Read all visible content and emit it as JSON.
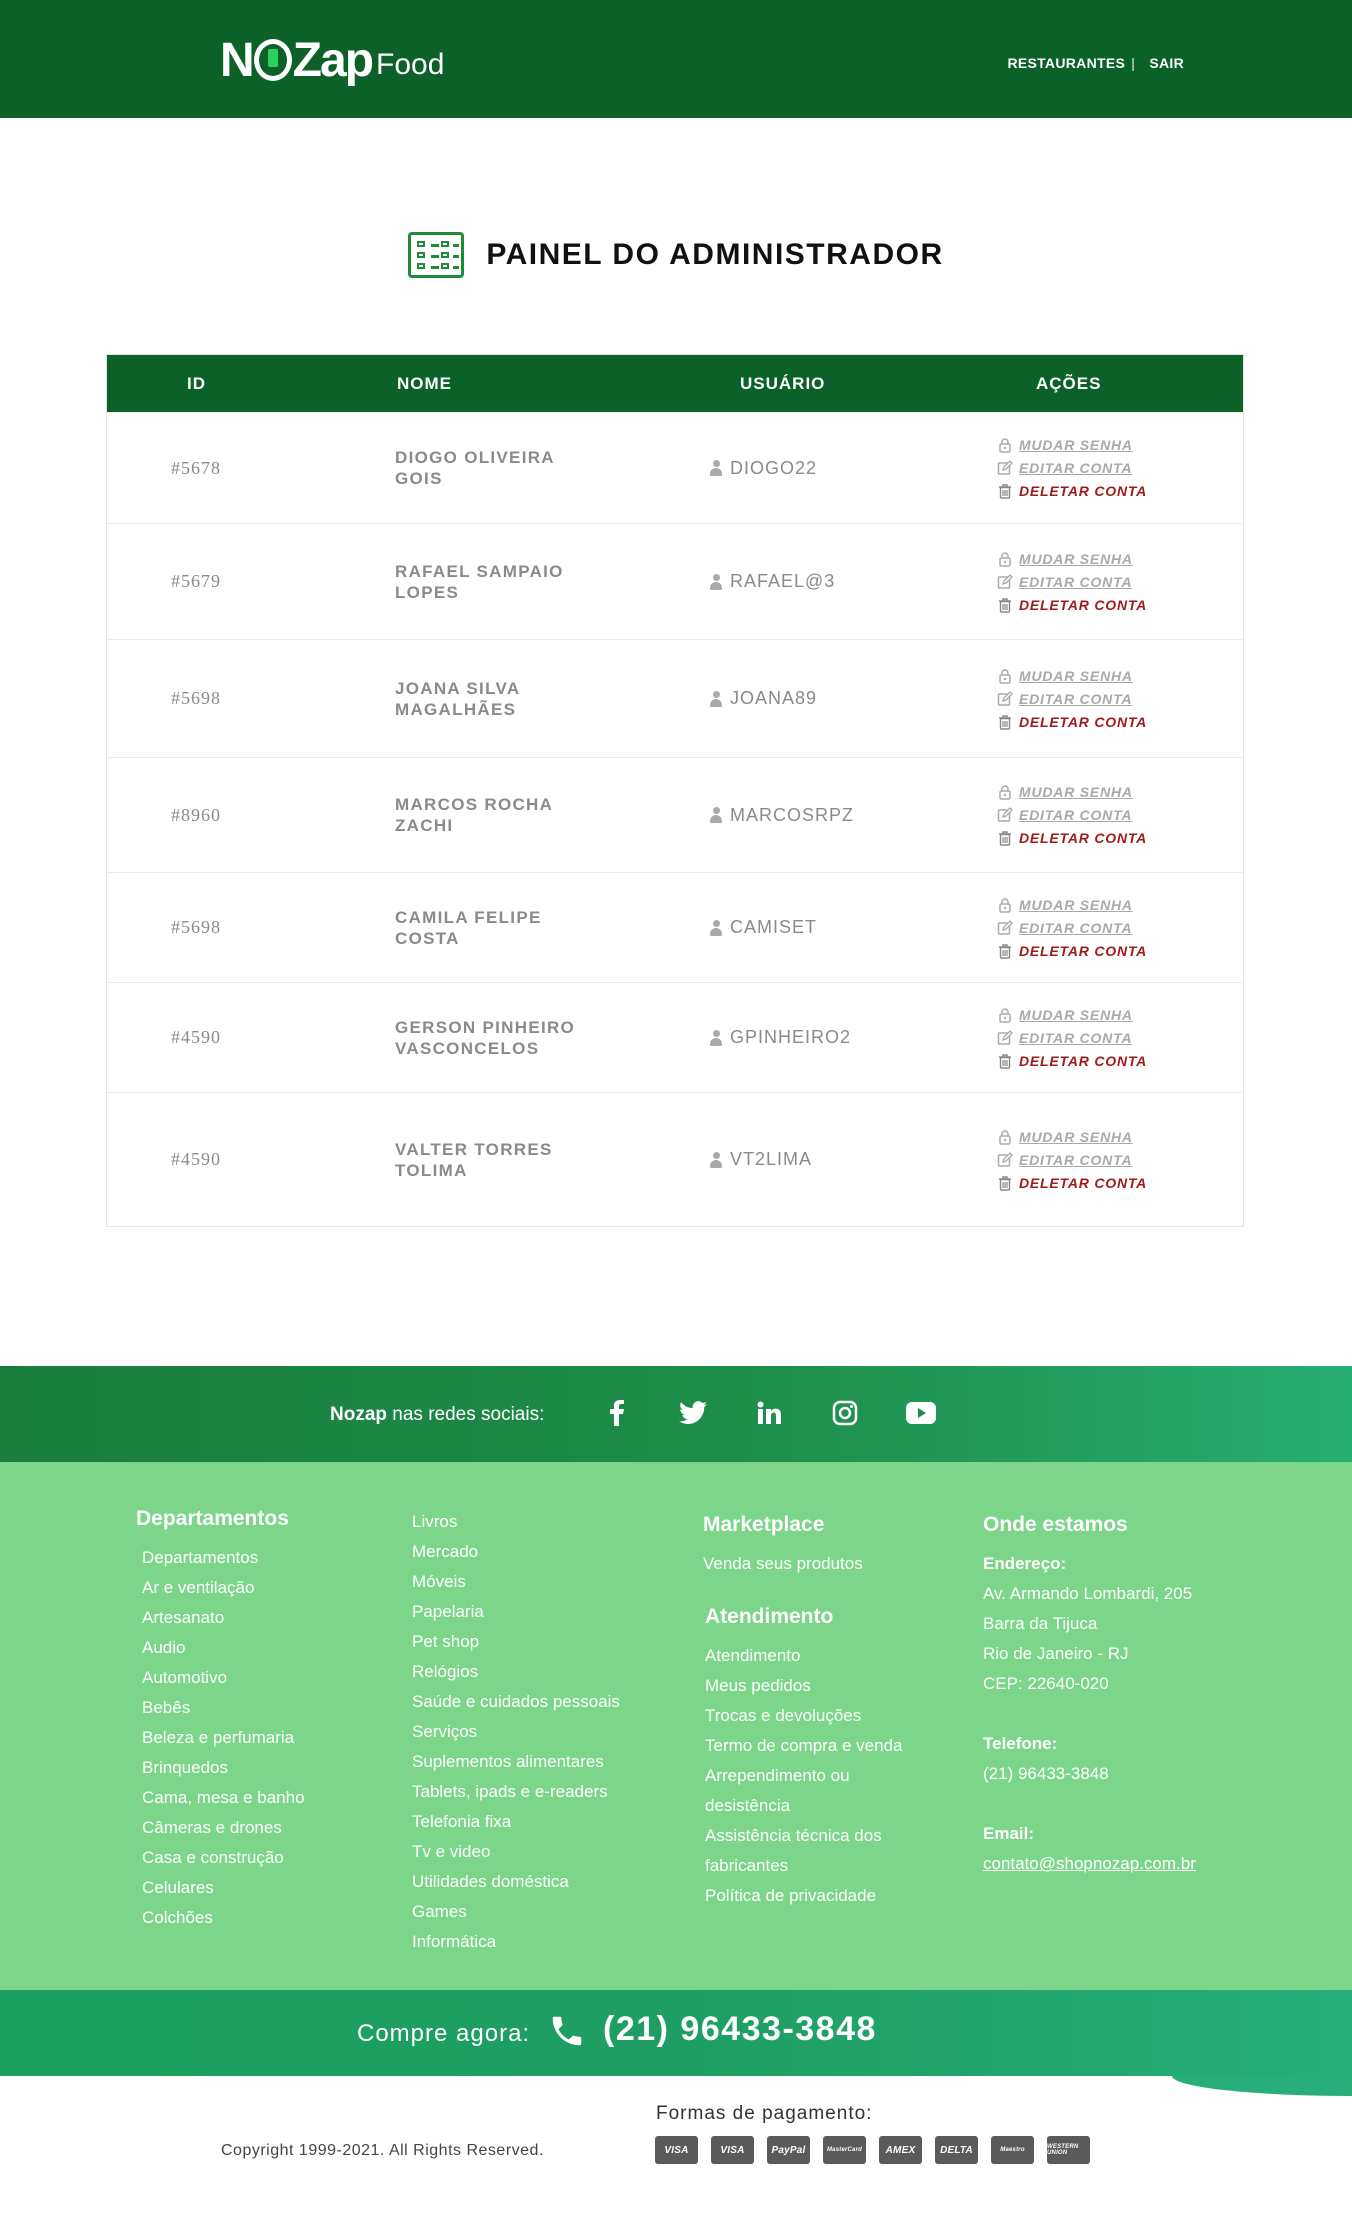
{
  "header": {
    "logo_main": "NOZap",
    "logo_sub": "Food",
    "nav": [
      "RESTAURANTES",
      "SAIR"
    ],
    "nav_separator": "|"
  },
  "page": {
    "title": "PAINEL DO ADMINISTRADOR",
    "title_icon": "admin-list-icon"
  },
  "table": {
    "headers": [
      "ID",
      "NOME",
      "USUÁRIO",
      "AÇÕES"
    ],
    "actions": {
      "change_password": "MUDAR SENHA",
      "edit": "EDITAR CONTA",
      "delete": "DELETAR CONTA"
    },
    "rows": [
      {
        "id": "#5678",
        "name": "DIOGO OLIVEIRA GOIS",
        "user": "DIOGO22"
      },
      {
        "id": "#5679",
        "name": "RAFAEL SAMPAIO LOPES",
        "user": "RAFAEL@3"
      },
      {
        "id": "#5698",
        "name": "JOANA SILVA MAGALHÃES",
        "user": "JOANA89"
      },
      {
        "id": "#8960",
        "name": "MARCOS ROCHA ZACHI",
        "user": "MARCOSRPZ"
      },
      {
        "id": "#5698",
        "name": "CAMILA FELIPE COSTA",
        "user": "CAMISET"
      },
      {
        "id": "#4590",
        "name": "GERSON PINHEIRO VASCONCELOS",
        "user": "GPINHEIRO2"
      },
      {
        "id": "#4590",
        "name": "VALTER TORRES TOLIMA",
        "user": "VT2LIMA"
      }
    ]
  },
  "social": {
    "brand": "Nozap",
    "text": "nas redes sociais:",
    "icons": [
      "facebook-icon",
      "twitter-icon",
      "linkedin-icon",
      "instagram-icon",
      "youtube-icon"
    ]
  },
  "footer": {
    "departamentos": {
      "title": "Departamentos",
      "col1": [
        "Departamentos",
        "Ar e ventilação",
        "Artesanato",
        "Audio",
        "Automotivo",
        "Bebês",
        "Beleza e perfumaria",
        "Brinquedos",
        "Cama, mesa e banho",
        "Câmeras e drones",
        "Casa e construção",
        "Celulares",
        "Colchões"
      ],
      "col2": [
        "Livros",
        "Mercado",
        "Móveis",
        "Papelaria",
        "Pet shop",
        "Relógios",
        "Saúde e cuidados pessoais",
        "Serviços",
        "Suplementos alimentares",
        "Tablets, ipads e e-readers",
        "Telefonia fixa",
        "Tv e video",
        "Utilidades doméstica",
        "Games",
        "Informática"
      ]
    },
    "marketplace": {
      "title": "Marketplace",
      "items": [
        "Venda seus produtos"
      ]
    },
    "atendimento": {
      "title": "Atendimento",
      "items": [
        "Atendimento",
        "Meus pedidos",
        "Trocas e devoluções",
        "Termo de compra e venda",
        "Arrependimento ou desistência",
        "Assistência técnica dos fabricantes",
        "Política de privacidade"
      ]
    },
    "onde": {
      "title": "Onde estamos",
      "endereco_label": "Endereço:",
      "endereco": [
        "Av. Armando Lombardi, 205",
        "Barra da Tijuca",
        "Rio de Janeiro - RJ",
        "CEP: 22640-020"
      ],
      "telefone_label": "Telefone:",
      "telefone": "(21) 96433-3848",
      "email_label": "Email:",
      "email": "contato@shopnozap.com.br"
    }
  },
  "phone_bar": {
    "label": "Compre agora:",
    "number": "(21) 96433-3848"
  },
  "bottom": {
    "copyright": "Copyright 1999-2021. All Rights Reserved.",
    "payment_label": "Formas de pagamento:",
    "payments": [
      "VISA",
      "VISA",
      "PayPal",
      "MasterCard",
      "AMEX",
      "DELTA",
      "Maestro",
      "WESTERN UNION"
    ]
  },
  "colors": {
    "header_green": "#0b6127",
    "footer_green": "#7dd589",
    "delete_red": "#9d1b1b"
  }
}
